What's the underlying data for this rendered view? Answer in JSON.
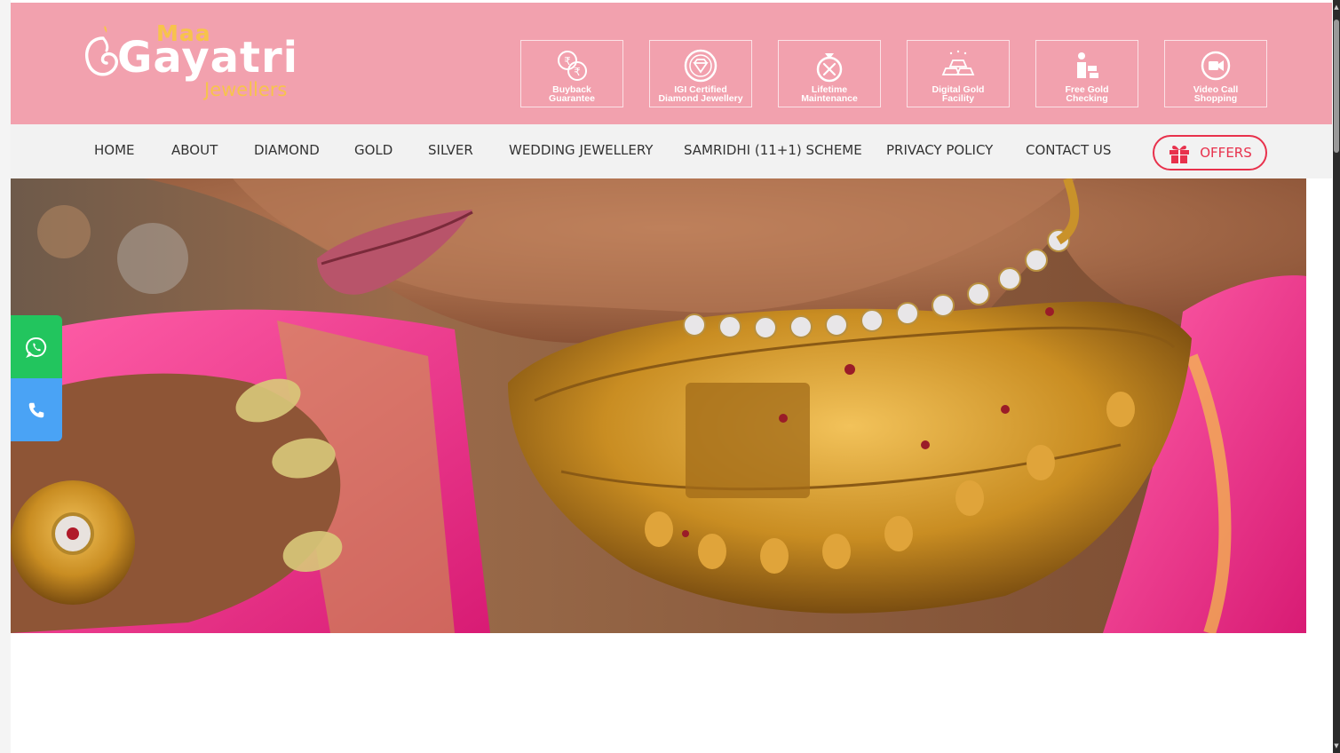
{
  "brand": {
    "line1": "Maa",
    "line2": "Gayatri",
    "line3": "Jewellers",
    "colors": {
      "header_bg": "#f2a1ae",
      "gold_text": "#f7c34c",
      "accent_red": "#e8314c",
      "nav_bg": "#f2f2f2"
    }
  },
  "features": [
    {
      "label": "Buyback\nGuarantee",
      "icon": "rupee-exchange-icon"
    },
    {
      "label": "IGI Certified\nDiamond Jewellery",
      "icon": "certified-badge-icon"
    },
    {
      "label": "Lifetime\nMaintenance",
      "icon": "ring-tools-icon"
    },
    {
      "label": "Digital Gold\nFacility",
      "icon": "gold-bars-icon"
    },
    {
      "label": "Free Gold\nChecking",
      "icon": "gold-checking-icon"
    },
    {
      "label": "Video Call\nShopping",
      "icon": "video-camera-icon"
    }
  ],
  "nav": {
    "items": [
      "HOME",
      "ABOUT",
      "DIAMOND",
      "GOLD",
      "SILVER",
      "WEDDING JEWELLERY",
      "SAMRIDHI (11+1) SCHEME",
      "PRIVACY POLICY",
      "CONTACT US"
    ],
    "offers_label": "OFFERS"
  },
  "floating": {
    "whatsapp_icon": "whatsapp-icon",
    "phone_icon": "phone-icon"
  }
}
